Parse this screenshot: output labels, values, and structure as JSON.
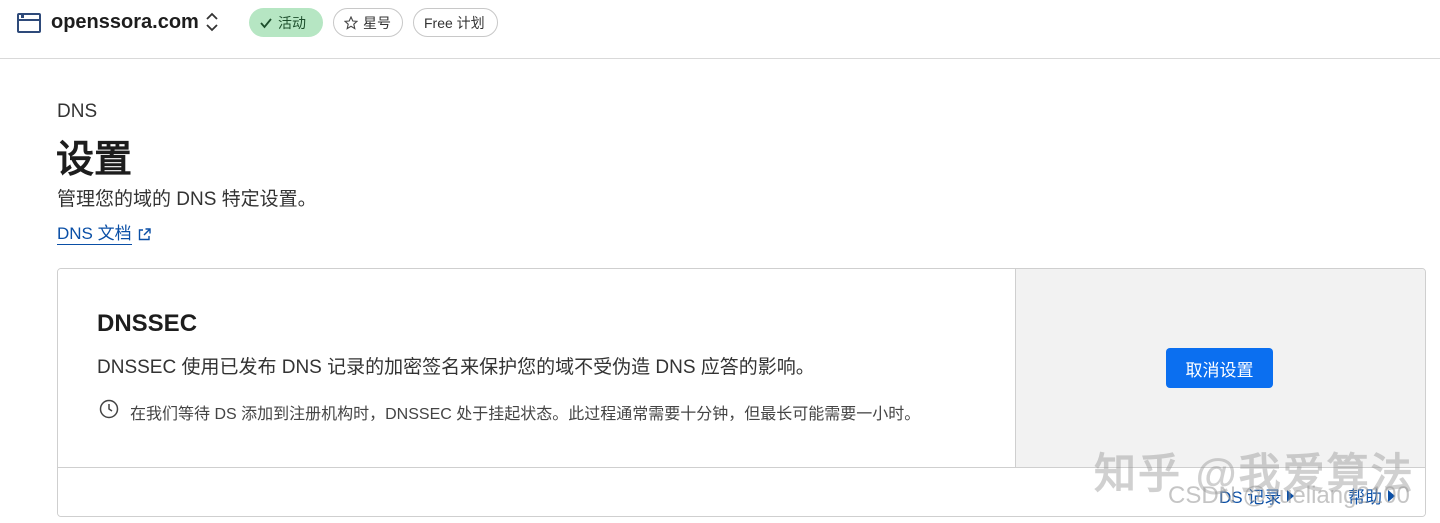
{
  "topbar": {
    "domain": "openssora.com",
    "status_label": "活动",
    "star_label": "星号",
    "plan_label": "Free 计划"
  },
  "header": {
    "section": "DNS",
    "title": "设置",
    "description": "管理您的域的 DNS 特定设置。",
    "docs_link": "DNS 文档"
  },
  "dnssec_card": {
    "title": "DNSSEC",
    "description": "DNSSEC 使用已发布 DNS 记录的加密签名来保护您的域不受伪造 DNS 应答的影响。",
    "note": "在我们等待 DS 添加到注册机构时，DNSSEC 处于挂起状态。此过程通常需要十分钟，但最长可能需要一小时。",
    "action_label": "取消设置",
    "footer_links": [
      "DS 记录",
      "帮助"
    ]
  },
  "watermark": {
    "main": "知乎 @我爱算法",
    "sub": "CSDN @yueliang2100"
  },
  "colors": {
    "accent": "#0b6ff0",
    "link": "#0a4fa6",
    "active_pill_bg": "#b6e6c3",
    "side_panel_bg": "#f2f2f2"
  },
  "icons": {
    "site": "browser-window-icon",
    "switch": "chevron-updown-icon",
    "active": "check-icon",
    "star": "star-icon",
    "external": "external-link-icon",
    "note": "clock-icon",
    "footer_caret": "caret-right-icon"
  }
}
